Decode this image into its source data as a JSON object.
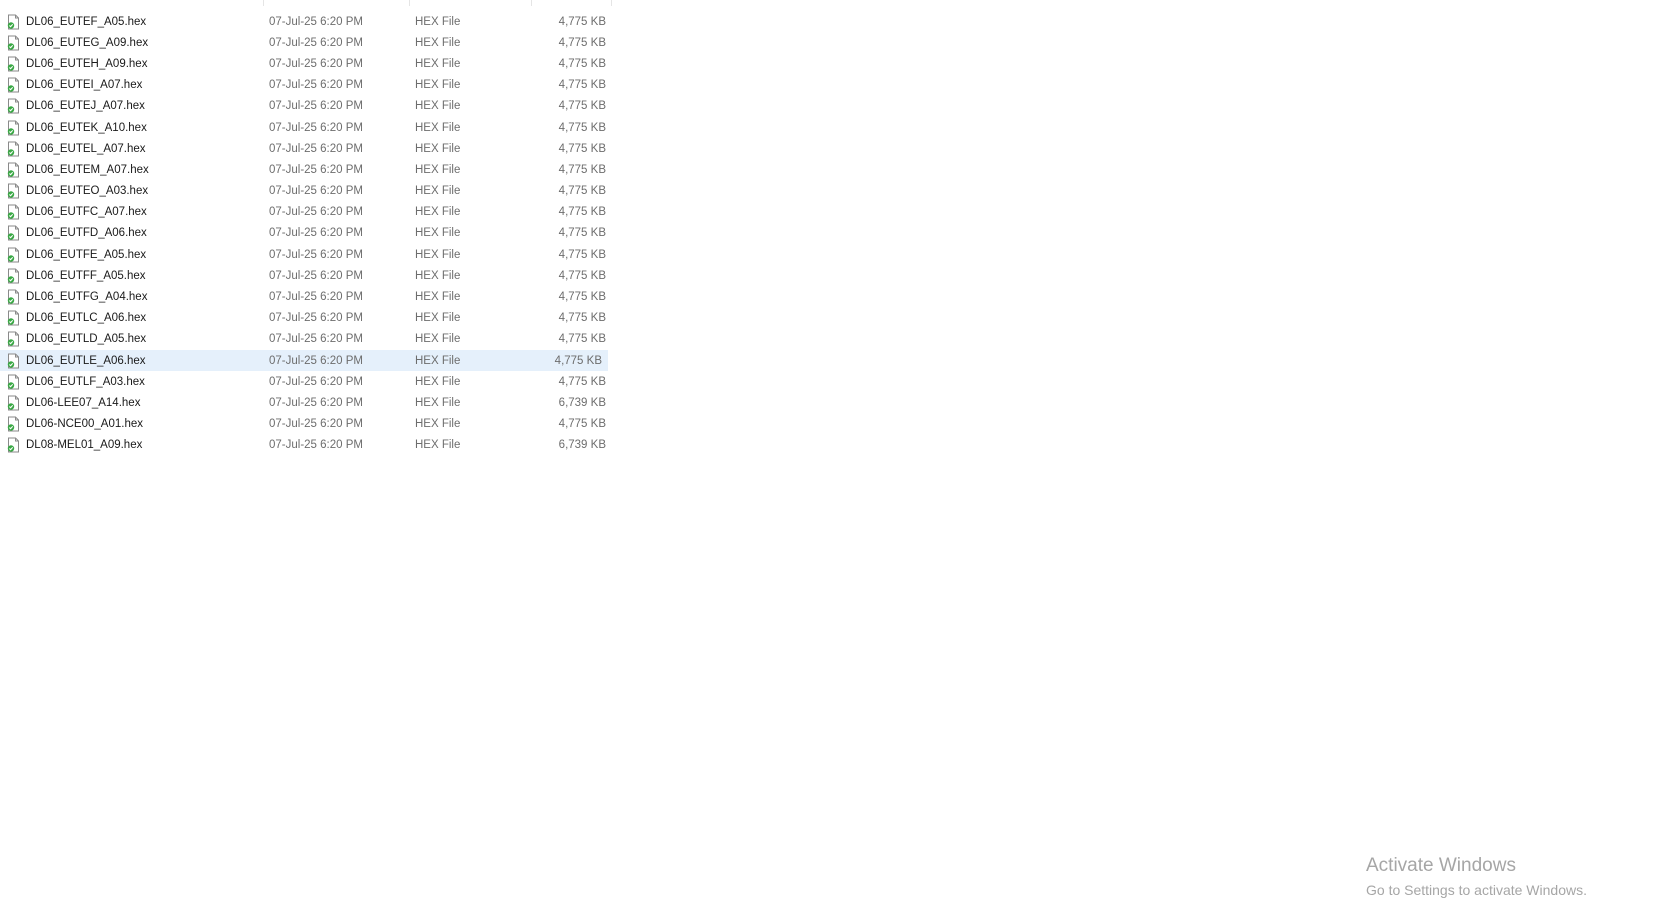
{
  "files": [
    {
      "name": "DL06_EUTEF_A05.hex",
      "date": "07-Jul-25 6:20 PM",
      "type": "HEX File",
      "size": "4,775 KB",
      "icon": "hex-file-icon"
    },
    {
      "name": "DL06_EUTEG_A09.hex",
      "date": "07-Jul-25 6:20 PM",
      "type": "HEX File",
      "size": "4,775 KB",
      "icon": "hex-file-icon"
    },
    {
      "name": "DL06_EUTEH_A09.hex",
      "date": "07-Jul-25 6:20 PM",
      "type": "HEX File",
      "size": "4,775 KB",
      "icon": "hex-file-icon"
    },
    {
      "name": "DL06_EUTEI_A07.hex",
      "date": "07-Jul-25 6:20 PM",
      "type": "HEX File",
      "size": "4,775 KB",
      "icon": "hex-file-icon"
    },
    {
      "name": "DL06_EUTEJ_A07.hex",
      "date": "07-Jul-25 6:20 PM",
      "type": "HEX File",
      "size": "4,775 KB",
      "icon": "hex-file-icon"
    },
    {
      "name": "DL06_EUTEK_A10.hex",
      "date": "07-Jul-25 6:20 PM",
      "type": "HEX File",
      "size": "4,775 KB",
      "icon": "hex-file-icon"
    },
    {
      "name": "DL06_EUTEL_A07.hex",
      "date": "07-Jul-25 6:20 PM",
      "type": "HEX File",
      "size": "4,775 KB",
      "icon": "hex-file-icon"
    },
    {
      "name": "DL06_EUTEM_A07.hex",
      "date": "07-Jul-25 6:20 PM",
      "type": "HEX File",
      "size": "4,775 KB",
      "icon": "hex-file-icon"
    },
    {
      "name": "DL06_EUTEO_A03.hex",
      "date": "07-Jul-25 6:20 PM",
      "type": "HEX File",
      "size": "4,775 KB",
      "icon": "hex-file-icon"
    },
    {
      "name": "DL06_EUTFC_A07.hex",
      "date": "07-Jul-25 6:20 PM",
      "type": "HEX File",
      "size": "4,775 KB",
      "icon": "hex-file-icon"
    },
    {
      "name": "DL06_EUTFD_A06.hex",
      "date": "07-Jul-25 6:20 PM",
      "type": "HEX File",
      "size": "4,775 KB",
      "icon": "hex-file-icon"
    },
    {
      "name": "DL06_EUTFE_A05.hex",
      "date": "07-Jul-25 6:20 PM",
      "type": "HEX File",
      "size": "4,775 KB",
      "icon": "hex-file-icon"
    },
    {
      "name": "DL06_EUTFF_A05.hex",
      "date": "07-Jul-25 6:20 PM",
      "type": "HEX File",
      "size": "4,775 KB",
      "icon": "hex-file-icon"
    },
    {
      "name": "DL06_EUTFG_A04.hex",
      "date": "07-Jul-25 6:20 PM",
      "type": "HEX File",
      "size": "4,775 KB",
      "icon": "hex-file-icon"
    },
    {
      "name": "DL06_EUTLC_A06.hex",
      "date": "07-Jul-25 6:20 PM",
      "type": "HEX File",
      "size": "4,775 KB",
      "icon": "hex-file-icon"
    },
    {
      "name": "DL06_EUTLD_A05.hex",
      "date": "07-Jul-25 6:20 PM",
      "type": "HEX File",
      "size": "4,775 KB",
      "icon": "hex-file-icon"
    },
    {
      "name": "DL06_EUTLE_A06.hex",
      "date": "07-Jul-25 6:20 PM",
      "type": "HEX File",
      "size": "4,775 KB",
      "icon": "hex-file-icon",
      "selected": true
    },
    {
      "name": "DL06_EUTLF_A03.hex",
      "date": "07-Jul-25 6:20 PM",
      "type": "HEX File",
      "size": "4,775 KB",
      "icon": "hex-file-icon"
    },
    {
      "name": "DL06-LEE07_A14.hex",
      "date": "07-Jul-25 6:20 PM",
      "type": "HEX File",
      "size": "6,739 KB",
      "icon": "hex-file-icon"
    },
    {
      "name": "DL06-NCE00_A01.hex",
      "date": "07-Jul-25 6:20 PM",
      "type": "HEX File",
      "size": "4,775 KB",
      "icon": "hex-file-icon"
    },
    {
      "name": "DL08-MEL01_A09.hex",
      "date": "07-Jul-25 6:20 PM",
      "type": "HEX File",
      "size": "6,739 KB",
      "icon": "hex-file-icon"
    }
  ],
  "watermark": {
    "title": "Activate Windows",
    "subtitle": "Go to Settings to activate Windows."
  },
  "colors": {
    "selected_row": "#e5f0fb",
    "icon_green": "#3aa845",
    "text_secondary": "#6d6d6d",
    "watermark": "#a6a6a6"
  }
}
